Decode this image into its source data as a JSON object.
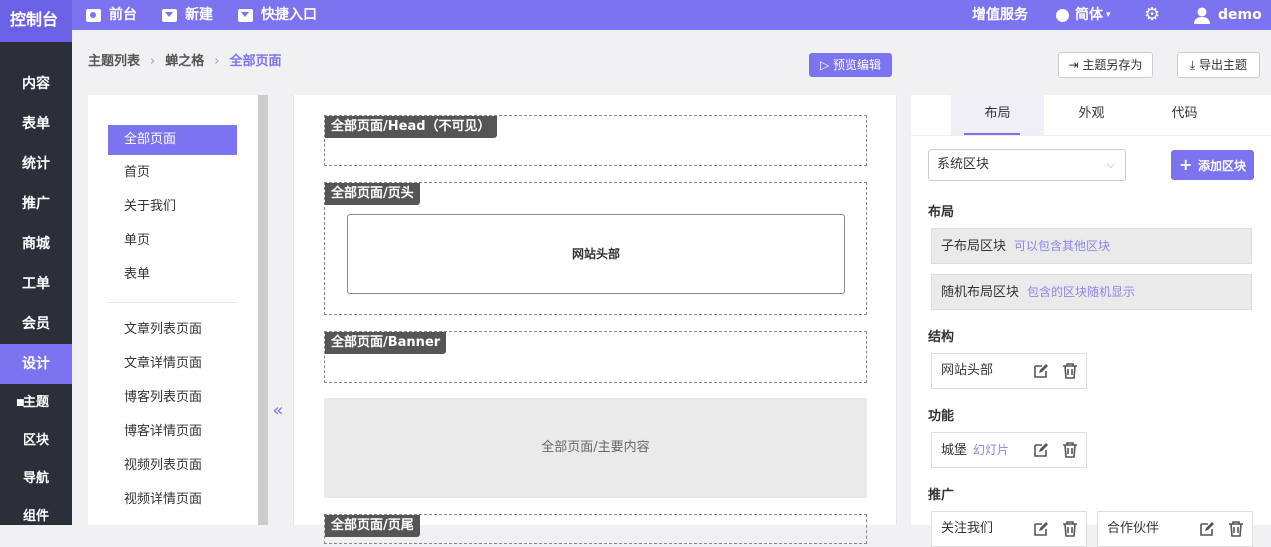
{
  "topbar": {
    "logo": "控制台",
    "nav": [
      "前台",
      "新建",
      "快捷入口"
    ],
    "value_added": "增值服务",
    "language": "简体",
    "user": "demo"
  },
  "sidebar": {
    "items": [
      "内容",
      "表单",
      "统计",
      "推广",
      "商城",
      "工单",
      "会员",
      "设计"
    ],
    "sub": [
      "主题",
      "区块",
      "导航",
      "组件"
    ]
  },
  "breadcrumb": {
    "items": [
      "主题列表",
      "蝉之格",
      "全部页面"
    ]
  },
  "buttons": {
    "preview": "预览编辑",
    "save_as": "主题另存为",
    "export": "导出主题"
  },
  "pages": {
    "group1": [
      "全部页面",
      "首页",
      "关于我们",
      "单页",
      "表单"
    ],
    "group2": [
      "文章列表页面",
      "文章详情页面",
      "博客列表页面",
      "博客详情页面",
      "视频列表页面",
      "视频详情页面"
    ]
  },
  "canvas": {
    "zones": [
      "全部页面/Head（不可见）",
      "全部页面/页头",
      "全部页面/Banner",
      "全部页面/页尾"
    ],
    "header_block": "网站头部",
    "main": "全部页面/主要内容",
    "collapse": "«"
  },
  "right": {
    "tabs": [
      "布局",
      "外观",
      "代码"
    ],
    "select": "系统区块",
    "add": "添加区块",
    "layout_title": "布局",
    "layouts": [
      {
        "name": "子布局区块",
        "desc": "可以包含其他区块"
      },
      {
        "name": "随机布局区块",
        "desc": "包含的区块随机显示"
      }
    ],
    "structure_title": "结构",
    "structure": [
      {
        "name": "网站头部",
        "desc": ""
      }
    ],
    "function_title": "功能",
    "function": [
      {
        "name": "城堡",
        "desc": "幻灯片"
      }
    ],
    "promo_title": "推广",
    "promo": [
      {
        "name": "关注我们",
        "desc": ""
      },
      {
        "name": "合作伙伴",
        "desc": ""
      }
    ]
  }
}
